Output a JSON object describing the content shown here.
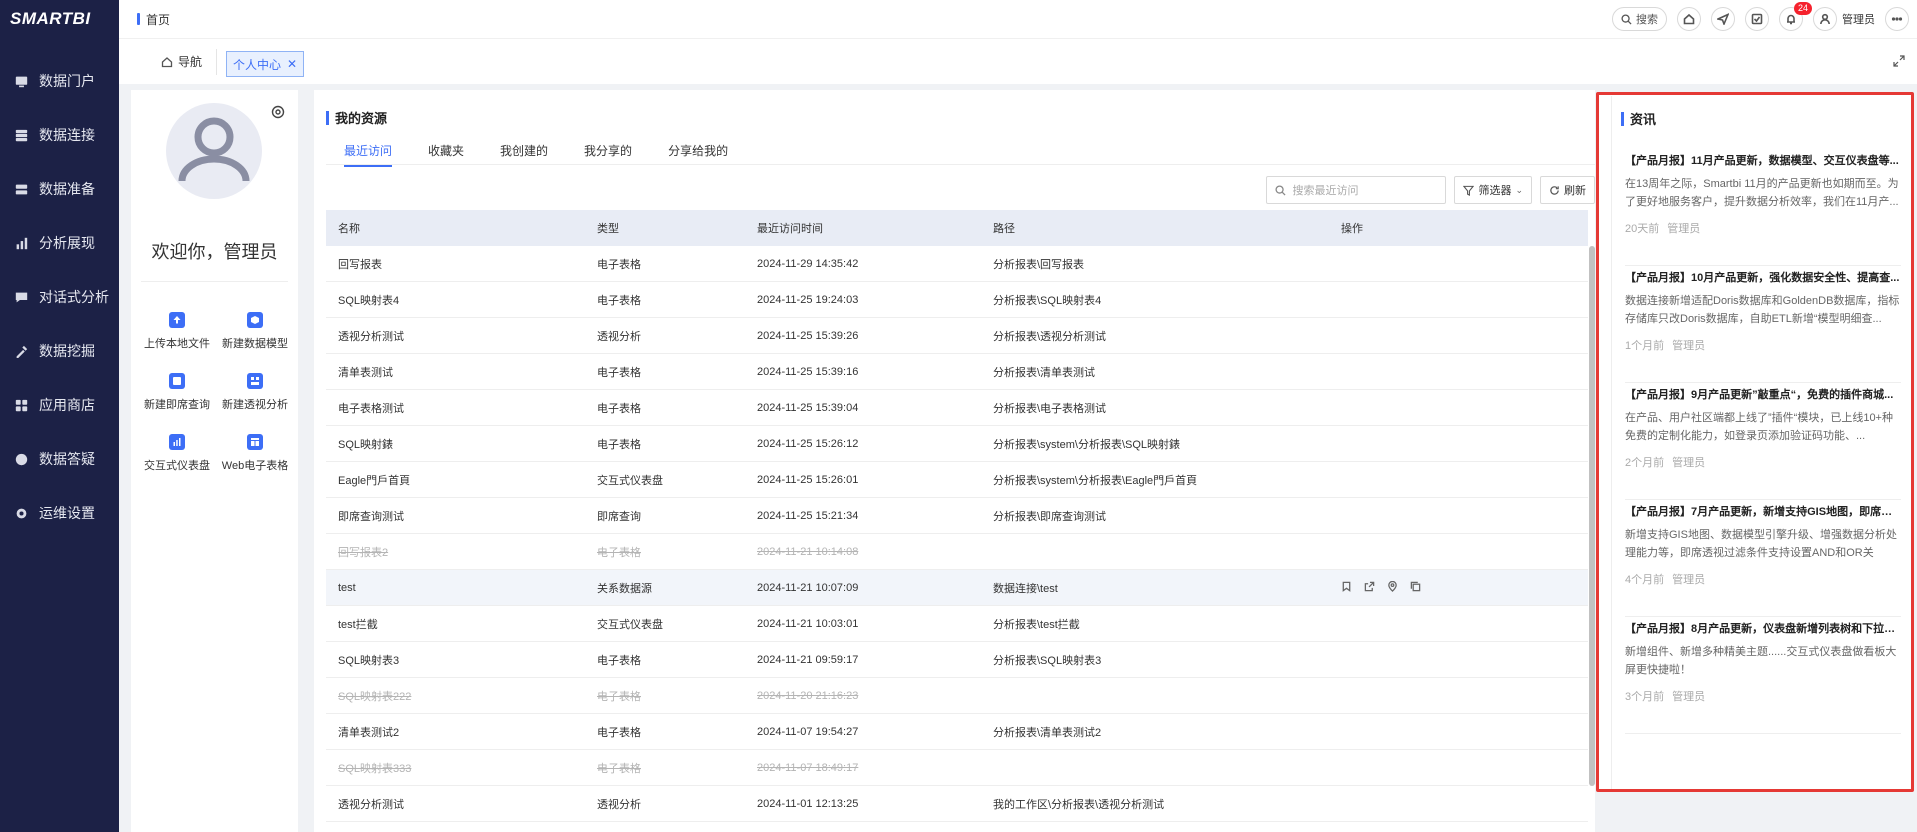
{
  "app": {
    "logo": "SMARTBI"
  },
  "sidebar": {
    "items": [
      {
        "label": "数据门户",
        "icon": "portal-icon"
      },
      {
        "label": "数据连接",
        "icon": "database-icon"
      },
      {
        "label": "数据准备",
        "icon": "prepare-icon"
      },
      {
        "label": "分析展现",
        "icon": "chart-icon"
      },
      {
        "label": "对话式分析",
        "icon": "chat-icon"
      },
      {
        "label": "数据挖掘",
        "icon": "mining-icon"
      },
      {
        "label": "应用商店",
        "icon": "store-icon"
      },
      {
        "label": "数据答疑",
        "icon": "help-icon"
      },
      {
        "label": "运维设置",
        "icon": "settings-icon"
      }
    ]
  },
  "topbar": {
    "breadcrumb": "首页",
    "search_label": "搜索",
    "notification_count": "24",
    "user_name": "管理员"
  },
  "tabs": {
    "nav_label": "导航",
    "active_label": "个人中心"
  },
  "profile": {
    "welcome": "欢迎你，管理员",
    "actions": [
      {
        "label": "上传本地文件",
        "icon": "upload-icon"
      },
      {
        "label": "新建数据模型",
        "icon": "cube-icon"
      },
      {
        "label": "新建即席查询",
        "icon": "query-icon"
      },
      {
        "label": "新建透视分析",
        "icon": "pivot-icon"
      },
      {
        "label": "交互式仪表盘",
        "icon": "dashboard-icon"
      },
      {
        "label": "Web电子表格",
        "icon": "sheet-icon"
      }
    ]
  },
  "resources": {
    "title": "我的资源",
    "tabs": [
      "最近访问",
      "收藏夹",
      "我创建的",
      "我分享的",
      "分享给我的"
    ],
    "active_tab": 0,
    "search_placeholder": "搜索最近访问",
    "filter_label": "筛选器",
    "refresh_label": "刷新",
    "columns": [
      "名称",
      "类型",
      "最近访问时间",
      "路径",
      "操作"
    ],
    "rows": [
      {
        "name": "回写报表",
        "type": "电子表格",
        "time": "2024-11-29 14:35:42",
        "path": "分析报表\\回写报表",
        "deleted": false
      },
      {
        "name": "SQL映射表4",
        "type": "电子表格",
        "time": "2024-11-25 19:24:03",
        "path": "分析报表\\SQL映射表4",
        "deleted": false
      },
      {
        "name": "透视分析测试",
        "type": "透视分析",
        "time": "2024-11-25 15:39:26",
        "path": "分析报表\\透视分析测试",
        "deleted": false
      },
      {
        "name": "清单表测试",
        "type": "电子表格",
        "time": "2024-11-25 15:39:16",
        "path": "分析报表\\清单表测试",
        "deleted": false
      },
      {
        "name": "电子表格测试",
        "type": "电子表格",
        "time": "2024-11-25 15:39:04",
        "path": "分析报表\\电子表格测试",
        "deleted": false
      },
      {
        "name": "SQL映射錶",
        "type": "电子表格",
        "time": "2024-11-25 15:26:12",
        "path": "分析报表\\system\\分析报表\\SQL映射錶",
        "deleted": false
      },
      {
        "name": "Eagle門戶首頁",
        "type": "交互式仪表盘",
        "time": "2024-11-25 15:26:01",
        "path": "分析报表\\system\\分析报表\\Eagle門戶首頁",
        "deleted": false
      },
      {
        "name": "即席查询测试",
        "type": "即席查询",
        "time": "2024-11-25 15:21:34",
        "path": "分析报表\\即席查询测试",
        "deleted": false
      },
      {
        "name": "回写报表2",
        "type": "电子表格",
        "time": "2024-11-21 10:14:08",
        "path": "",
        "deleted": true
      },
      {
        "name": "test",
        "type": "关系数据源",
        "time": "2024-11-21 10:07:09",
        "path": "数据连接\\test",
        "deleted": false,
        "highlight": true
      },
      {
        "name": "test拦截",
        "type": "交互式仪表盘",
        "time": "2024-11-21 10:03:01",
        "path": "分析报表\\test拦截",
        "deleted": false
      },
      {
        "name": "SQL映射表3",
        "type": "电子表格",
        "time": "2024-11-21 09:59:17",
        "path": "分析报表\\SQL映射表3",
        "deleted": false
      },
      {
        "name": "SQL映射表222",
        "type": "电子表格",
        "time": "2024-11-20 21:16:23",
        "path": "",
        "deleted": true
      },
      {
        "name": "清单表测试2",
        "type": "电子表格",
        "time": "2024-11-07 19:54:27",
        "path": "分析报表\\清单表测试2",
        "deleted": false
      },
      {
        "name": "SQL映射表333",
        "type": "电子表格",
        "time": "2024-11-07 18:49:17",
        "path": "",
        "deleted": true
      },
      {
        "name": "透视分析测试",
        "type": "透视分析",
        "time": "2024-11-01 12:13:25",
        "path": "我的工作区\\分析报表\\透视分析测试",
        "deleted": false
      }
    ],
    "row_operations": [
      "bookmark-icon",
      "open-icon",
      "locate-icon",
      "copy-icon"
    ]
  },
  "news": {
    "title": "资讯",
    "items": [
      {
        "title": "【产品月报】11月产品更新，数据模型、交互仪表盘等...",
        "body": "在13周年之际，Smartbi 11月的产品更新也如期而至。为了更好地服务客户，提升数据分析效率，我们在11月产...",
        "time": "20天前",
        "author": "管理员"
      },
      {
        "title": "【产品月报】10月产品更新，强化数据安全性、提高查...",
        "body": "数据连接新增适配Doris数据库和GoldenDB数据库，指标存储库只改Doris数据库，自助ETL新增“模型明细查...",
        "time": "1个月前",
        "author": "管理员"
      },
      {
        "title": "【产品月报】9月产品更新”敲重点“，免费的插件商城...",
        "body": "在产品、用户社区端都上线了”插件“模块，已上线10+种免费的定制化能力，如登录页添加验证码功能、...",
        "time": "2个月前",
        "author": "管理员"
      },
      {
        "title": "【产品月报】7月产品更新，新增支持GIS地图，即席透...",
        "body": "新增支持GIS地图、数据模型引擎升级、增强数据分析处理能力等，即席透视过滤条件支持设置AND和OR关系、...",
        "time": "4个月前",
        "author": "管理员"
      },
      {
        "title": "【产品月报】8月产品更新，仪表盘新增列表树和下拉树...",
        "body": "新增组件、新增多种精美主题......交互式仪表盘做看板大屏更快捷啦！",
        "time": "3个月前",
        "author": "管理员"
      }
    ]
  },
  "colors": {
    "sidebar_bg": "#1c2146",
    "accent": "#3d6ef6",
    "highlight_border": "#e53935"
  }
}
